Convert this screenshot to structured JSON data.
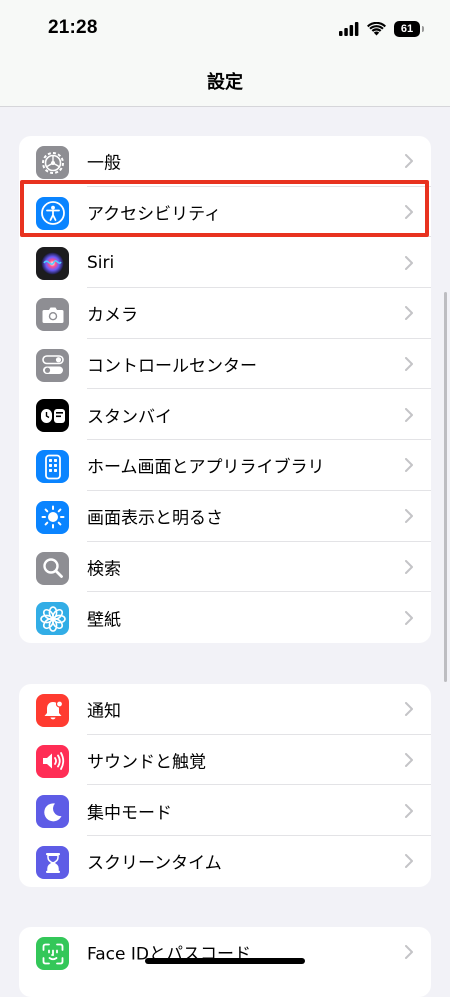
{
  "status_bar": {
    "time": "21:28",
    "battery": "61",
    "icons": [
      "signal-icon",
      "wifi-icon",
      "battery-icon"
    ]
  },
  "header": {
    "title": "設定"
  },
  "groups": [
    {
      "items": [
        {
          "label": "一般",
          "icon": "gear-icon",
          "color": "#8e8e93"
        },
        {
          "label": "アクセシビリティ",
          "icon": "accessibility-icon",
          "color": "#0a84ff",
          "highlighted": true
        },
        {
          "label": "Siri",
          "icon": "siri-icon",
          "color": "#1c1c1e"
        },
        {
          "label": "カメラ",
          "icon": "camera-icon",
          "color": "#8e8e93"
        },
        {
          "label": "コントロールセンター",
          "icon": "toggles-icon",
          "color": "#8e8e93"
        },
        {
          "label": "スタンバイ",
          "icon": "standby-icon",
          "color": "#000000"
        },
        {
          "label": "ホーム画面とアプリライブラリ",
          "icon": "home-screen-icon",
          "color": "#0a84ff"
        },
        {
          "label": "画面表示と明るさ",
          "icon": "brightness-icon",
          "color": "#0a84ff"
        },
        {
          "label": "検索",
          "icon": "search-icon",
          "color": "#8e8e93"
        },
        {
          "label": "壁紙",
          "icon": "wallpaper-flower-icon",
          "color": "#32ade6"
        }
      ]
    },
    {
      "items": [
        {
          "label": "通知",
          "icon": "bell-icon",
          "color": "#ff3b30"
        },
        {
          "label": "サウンドと触覚",
          "icon": "speaker-icon",
          "color": "#ff2d55"
        },
        {
          "label": "集中モード",
          "icon": "moon-icon",
          "color": "#5e5ce6"
        },
        {
          "label": "スクリーンタイム",
          "icon": "hourglass-icon",
          "color": "#5e5ce6"
        }
      ]
    },
    {
      "items": [
        {
          "label": "Face IDとパスコード",
          "icon": "faceid-icon",
          "color": "#34c759"
        }
      ]
    }
  ]
}
